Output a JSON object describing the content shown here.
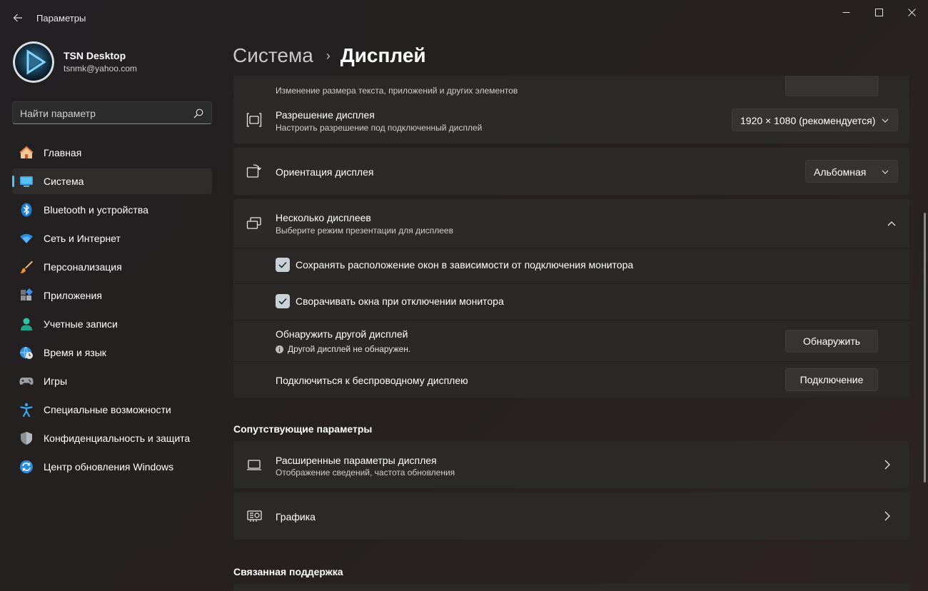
{
  "window": {
    "title": "Параметры",
    "back_icon": "arrow-left-icon"
  },
  "profile": {
    "name": "TSN Desktop",
    "email": "tsnmk@yahoo.com"
  },
  "search": {
    "placeholder": "Найти параметр"
  },
  "sidebar": {
    "items": [
      {
        "label": "Главная",
        "icon": "home-icon",
        "active": false
      },
      {
        "label": "Система",
        "icon": "system-icon",
        "active": true
      },
      {
        "label": "Bluetooth и устройства",
        "icon": "bluetooth-icon",
        "active": false
      },
      {
        "label": "Сеть и Интернет",
        "icon": "wifi-icon",
        "active": false
      },
      {
        "label": "Персонализация",
        "icon": "brush-icon",
        "active": false
      },
      {
        "label": "Приложения",
        "icon": "apps-icon",
        "active": false
      },
      {
        "label": "Учетные записи",
        "icon": "account-icon",
        "active": false
      },
      {
        "label": "Время и язык",
        "icon": "time-language-icon",
        "active": false
      },
      {
        "label": "Игры",
        "icon": "gamepad-icon",
        "active": false
      },
      {
        "label": "Специальные возможности",
        "icon": "accessibility-icon",
        "active": false
      },
      {
        "label": "Конфиденциальность и защита",
        "icon": "shield-icon",
        "active": false
      },
      {
        "label": "Центр обновления Windows",
        "icon": "update-icon",
        "active": false
      }
    ]
  },
  "breadcrumb": {
    "parent": "Система",
    "separator": "›",
    "current": "Дисплей"
  },
  "settings": {
    "scale_partial_sub": "Изменение размера текста, приложений и других элементов",
    "resolution": {
      "title": "Разрешение дисплея",
      "subtitle": "Настроить разрешение под подключенный дисплей",
      "value": "1920 × 1080 (рекомендуется)"
    },
    "orientation": {
      "title": "Ориентация дисплея",
      "value": "Альбомная"
    },
    "multiple": {
      "title": "Несколько дисплеев",
      "subtitle": "Выберите режим презентации для дисплеев",
      "expanded": true,
      "remember_windows": {
        "label": "Сохранять расположение окон в зависимости от подключения монитора",
        "checked": true
      },
      "minimize_windows": {
        "label": "Сворачивать окна при отключении монитора",
        "checked": true
      },
      "detect": {
        "title": "Обнаружить другой дисплей",
        "info": "Другой дисплей не обнаружен.",
        "button": "Обнаружить"
      },
      "wireless": {
        "title": "Подключиться к беспроводному дисплею",
        "button": "Подключение"
      }
    }
  },
  "related": {
    "heading": "Сопутствующие параметры",
    "advanced": {
      "title": "Расширенные параметры дисплея",
      "subtitle": "Отображение сведений, частота обновления"
    },
    "graphics": {
      "title": "Графика"
    }
  },
  "support": {
    "heading": "Связанная поддержка"
  },
  "colors": {
    "accent": "#4cc2ff",
    "card": "#2b2a29",
    "background": "#202020"
  }
}
